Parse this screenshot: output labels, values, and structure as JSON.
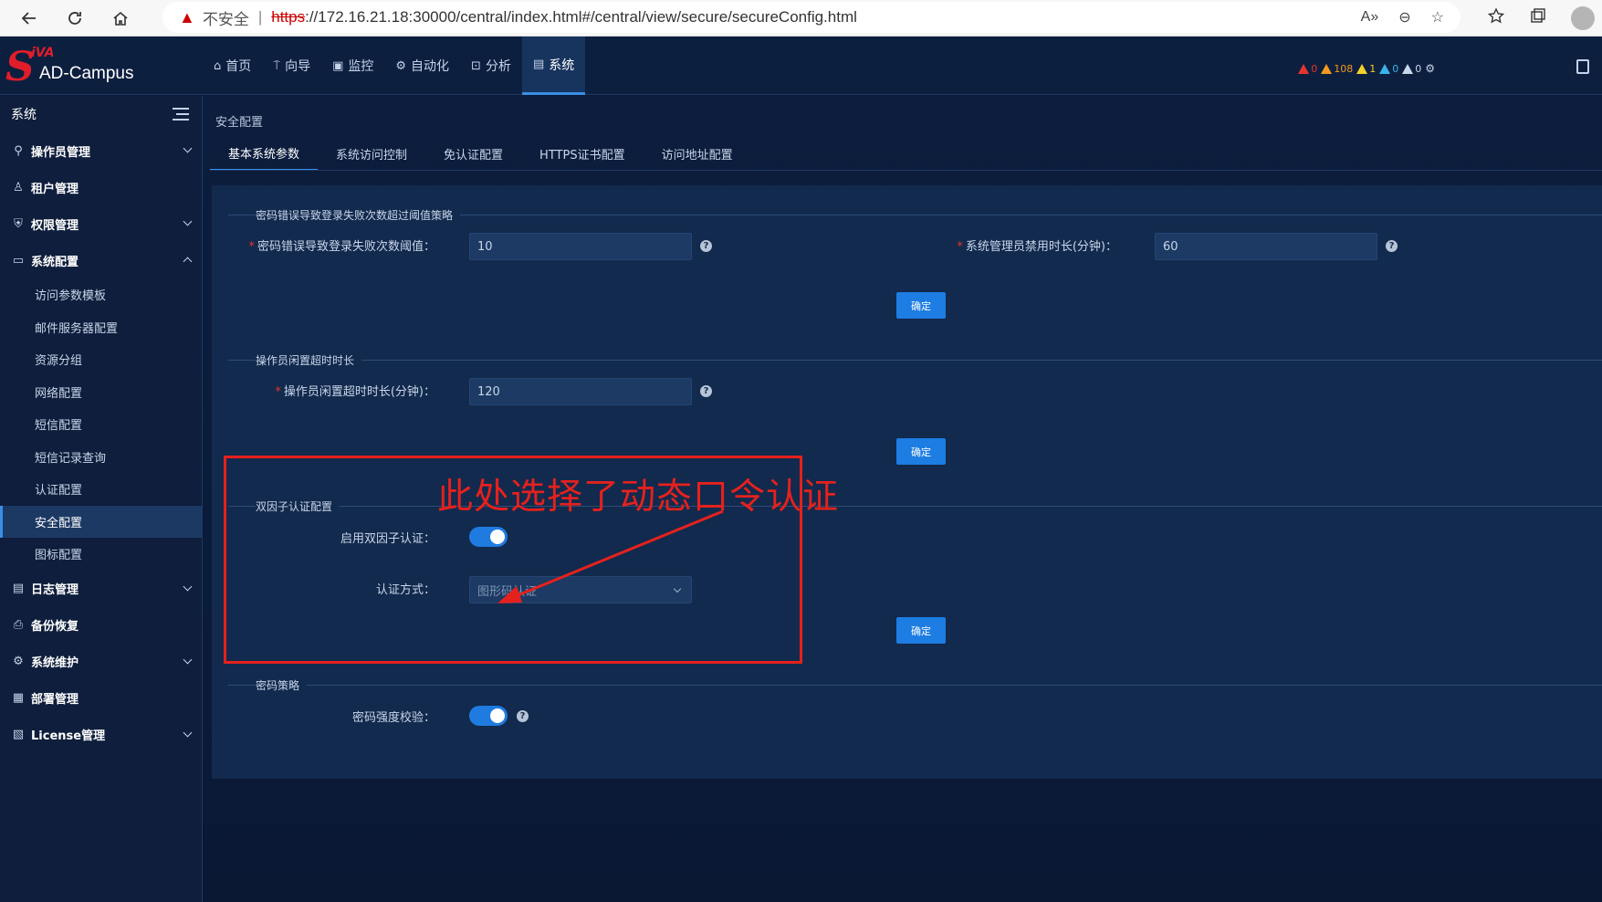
{
  "browser": {
    "insecure_label": "不安全",
    "url_protocol": "https",
    "url_rest": "://172.16.21.18:30000/central/index.html#/central/view/secure/secureConfig.html"
  },
  "app": {
    "logo_small": "iVA",
    "logo_name": "AD-Campus",
    "topnav": [
      {
        "label": "首页",
        "icon": "home-icon"
      },
      {
        "label": "向导",
        "icon": "guide-icon"
      },
      {
        "label": "监控",
        "icon": "monitor-icon"
      },
      {
        "label": "自动化",
        "icon": "automation-icon"
      },
      {
        "label": "分析",
        "icon": "analysis-icon"
      },
      {
        "label": "系统",
        "icon": "system-icon"
      }
    ],
    "alarms": [
      {
        "count": "0",
        "color": "#e5352f"
      },
      {
        "count": "108",
        "color": "#f39a1e"
      },
      {
        "count": "1",
        "color": "#f2d027"
      },
      {
        "count": "0",
        "color": "#3ab3e8"
      },
      {
        "count": "0",
        "color": "#c9d6ea"
      }
    ]
  },
  "sidebar": {
    "title": "系统",
    "groups": [
      {
        "label": "操作员管理",
        "icon": "operator-icon"
      },
      {
        "label": "租户管理",
        "icon": "tenant-icon"
      },
      {
        "label": "权限管理",
        "icon": "permission-icon"
      },
      {
        "label": "系统配置",
        "icon": "config-icon"
      },
      {
        "label": "日志管理",
        "icon": "log-icon"
      },
      {
        "label": "备份恢复",
        "icon": "backup-icon"
      },
      {
        "label": "系统维护",
        "icon": "maintenance-icon"
      },
      {
        "label": "部署管理",
        "icon": "deploy-icon"
      },
      {
        "label": "License管理",
        "icon": "license-icon"
      }
    ],
    "config_items": [
      "访问参数模板",
      "邮件服务器配置",
      "资源分组",
      "网络配置",
      "短信配置",
      "短信记录查询",
      "认证配置",
      "安全配置",
      "图标配置"
    ]
  },
  "main": {
    "breadcrumb": "安全配置",
    "tabs": [
      "基本系统参数",
      "系统访问控制",
      "免认证配置",
      "HTTPS证书配置",
      "访问地址配置"
    ],
    "sections": {
      "login_fail": {
        "title": "密码错误导致登录失败次数超过阈值策略",
        "threshold_label": "密码错误导致登录失败次数阈值：",
        "threshold_value": "10",
        "disable_label": "系统管理员禁用时长(分钟)：",
        "disable_value": "60",
        "ok": "确定"
      },
      "idle": {
        "title": "操作员闲置超时时长",
        "label": "操作员闲置超时时长(分钟)：",
        "value": "120",
        "ok": "确定"
      },
      "two_factor": {
        "title": "双因子认证配置",
        "enable_label": "启用双因子认证：",
        "enabled": true,
        "method_label": "认证方式：",
        "method_value": "图形码认证",
        "ok": "确定"
      },
      "password": {
        "title": "密码策略",
        "strength_label": "密码强度校验：",
        "enabled": true
      }
    }
  },
  "annotation": {
    "text": "此处选择了动态口令认证",
    "color": "#e5211d"
  }
}
